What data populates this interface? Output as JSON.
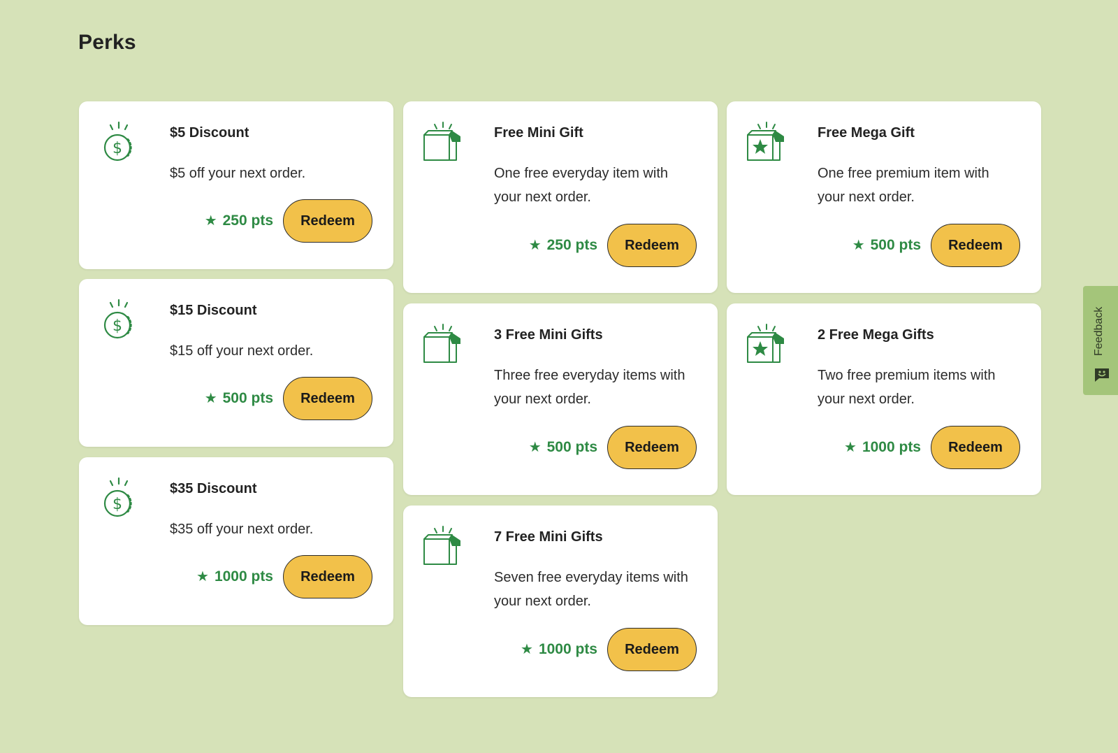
{
  "page": {
    "title": "Perks"
  },
  "colors": {
    "background": "#d6e2b8",
    "accent": "#2e8a44",
    "button": "#f2c14a",
    "feedback_tab": "#a4c57a"
  },
  "feedback": {
    "label": "Feedback",
    "icon": "smile-icon"
  },
  "perks": [
    {
      "title": "$5 Discount",
      "description": "$5 off your next order.",
      "points": "250 pts",
      "button": "Redeem",
      "icon": "dollar-coin-icon"
    },
    {
      "title": "$15 Discount",
      "description": "$15 off your next order.",
      "points": "500 pts",
      "button": "Redeem",
      "icon": "dollar-coin-icon"
    },
    {
      "title": "$35 Discount",
      "description": "$35 off your next order.",
      "points": "1000 pts",
      "button": "Redeem",
      "icon": "dollar-coin-icon"
    },
    {
      "title": "Free Mini Gift",
      "description": "One free everyday item with your next order.",
      "points": "250 pts",
      "button": "Redeem",
      "icon": "gift-box-icon"
    },
    {
      "title": "3 Free Mini Gifts",
      "description": "Three free everyday items with your next order.",
      "points": "500 pts",
      "button": "Redeem",
      "icon": "gift-box-icon"
    },
    {
      "title": "7 Free Mini Gifts",
      "description": "Seven free everyday items with your next order.",
      "points": "1000 pts",
      "button": "Redeem",
      "icon": "gift-box-icon"
    },
    {
      "title": "Free Mega Gift",
      "description": "One free premium item with your next order.",
      "points": "500 pts",
      "button": "Redeem",
      "icon": "star-gift-box-icon"
    },
    {
      "title": "2 Free Mega Gifts",
      "description": "Two free premium items with your next order.",
      "points": "1000 pts",
      "button": "Redeem",
      "icon": "star-gift-box-icon"
    }
  ]
}
